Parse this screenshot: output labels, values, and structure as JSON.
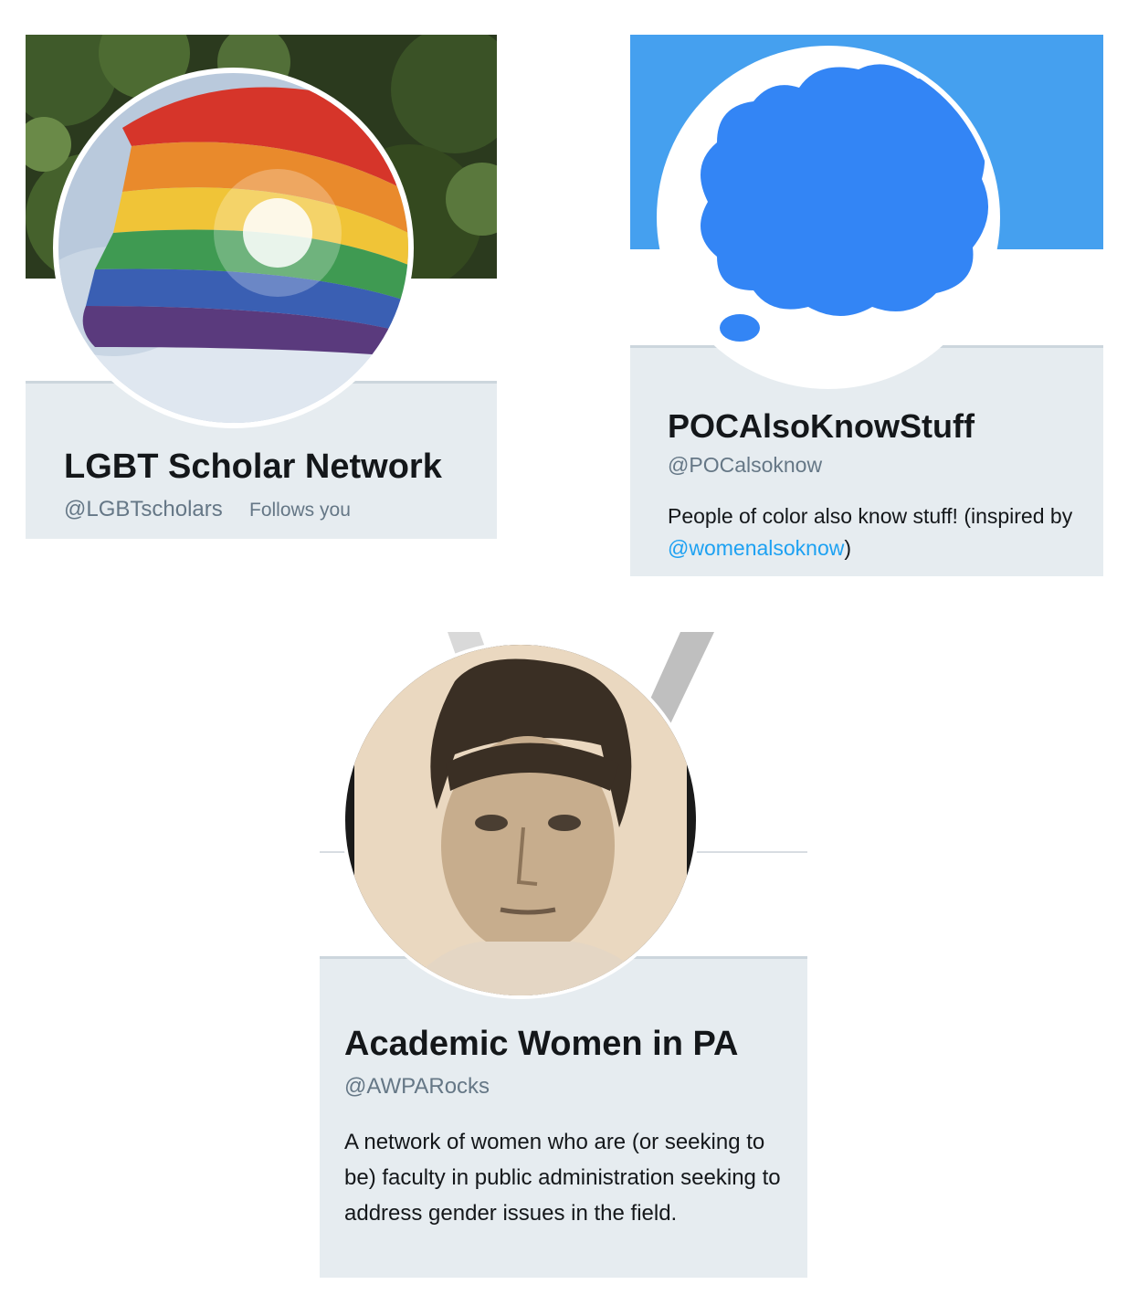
{
  "profiles": [
    {
      "name": "LGBT Scholar Network",
      "handle": "@LGBTscholars",
      "follows_you": "Follows you"
    },
    {
      "name": "POCAlsoKnowStuff",
      "handle": "@POCalsoknow",
      "bio_before": "People of color also know stuff! (inspired by ",
      "bio_mention": "@womenalsoknow",
      "bio_after": ")"
    },
    {
      "name": "Academic Women in PA",
      "handle": "@AWPARocks",
      "bio": "A network of women who are (or seeking to be) faculty in public administration seeking to address gender issues in the field."
    }
  ],
  "colors": {
    "info_background": "#e6ecf0",
    "name_text": "#14171a",
    "handle_text": "#657786",
    "mention_link": "#1da1f2",
    "poc_banner": "#45a0ef",
    "thought_bubble": "#3385f5"
  }
}
